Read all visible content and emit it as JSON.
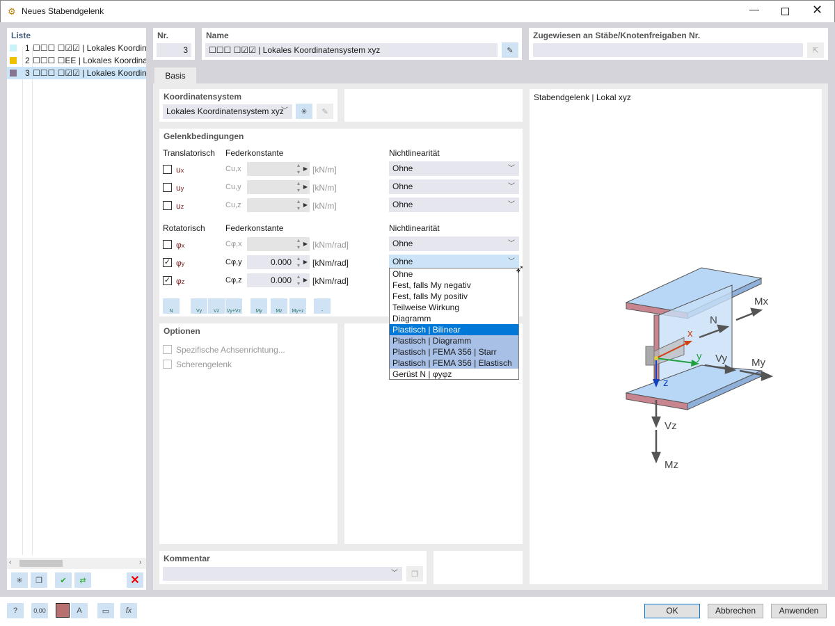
{
  "window": {
    "title": "Neues Stabendgelenk",
    "controls": [
      "minimize",
      "maximize",
      "close"
    ]
  },
  "list": {
    "header": "Liste",
    "items": [
      {
        "no": "1",
        "label": "☐☐☐ ☐☑☑ | Lokales Koordinatensystem xyz",
        "color": "#c8f4f8"
      },
      {
        "no": "2",
        "label": "☐☐☐ ☐EE | Lokales Koordinatensystem xyz",
        "color": "#f0c000"
      },
      {
        "no": "3",
        "label": "☐☐☐ ☐☑☑ | Lokales Koordinatensystem xyz",
        "color": "#857590",
        "selected": true
      }
    ]
  },
  "nr": {
    "label": "Nr.",
    "value": "3"
  },
  "name": {
    "label": "Name",
    "value": "☐☐☐ ☐☑☑ | Lokales Koordinatensystem xyz"
  },
  "assigned": {
    "label": "Zugewiesen an Stäbe/Knotenfreigaben Nr.",
    "value": ""
  },
  "tabs": [
    {
      "label": "Basis",
      "active": true
    }
  ],
  "coord": {
    "label": "Koordinatensystem",
    "value": "Lokales Koordinatensystem xyz"
  },
  "joint": {
    "label": "Gelenkbedingungen",
    "trans_label": "Translatorisch",
    "rot_label": "Rotatorisch",
    "spring_label": "Federkonstante",
    "nonlin_label": "Nichtlinearität",
    "trans": [
      {
        "name": "u",
        "sub": "x",
        "cname": "Cu,x",
        "checked": false,
        "value": "",
        "unit": "[kN/m]",
        "nonlin": "Ohne"
      },
      {
        "name": "u",
        "sub": "y",
        "cname": "Cu,y",
        "checked": false,
        "value": "",
        "unit": "[kN/m]",
        "nonlin": "Ohne"
      },
      {
        "name": "u",
        "sub": "z",
        "cname": "Cu,z",
        "checked": false,
        "value": "",
        "unit": "[kN/m]",
        "nonlin": "Ohne"
      }
    ],
    "rot": [
      {
        "name": "φ",
        "sub": "x",
        "cname": "Cφ,x",
        "checked": false,
        "value": "",
        "unit": "[kNm/rad]",
        "nonlin": "Ohne"
      },
      {
        "name": "φ",
        "sub": "y",
        "cname": "Cφ,y",
        "checked": true,
        "value": "0.000",
        "unit": "[kNm/rad]",
        "nonlin": "Ohne"
      },
      {
        "name": "φ",
        "sub": "z",
        "cname": "Cφ,z",
        "checked": true,
        "value": "0.000",
        "unit": "[kNm/rad]",
        "nonlin": "Ohne"
      }
    ],
    "quick_buttons": [
      "N",
      "Vy",
      "Vz",
      "Vy+Vz",
      "My",
      "Mz",
      "My+z",
      "-"
    ]
  },
  "dropdown": {
    "options": [
      "Ohne",
      "Fest, falls My negativ",
      "Fest, falls My positiv",
      "Teilweise Wirkung",
      "Diagramm",
      "Plastisch | Bilinear",
      "Plastisch | Diagramm",
      "Plastisch | FEMA 356 | Starr",
      "Plastisch | FEMA 356 | Elastisch",
      "Gerüst N | φyφz"
    ],
    "highlighted": "Plastisch | Bilinear"
  },
  "options": {
    "label": "Optionen",
    "items": [
      "Spezifische Achsenrichtung...",
      "Scherengelenk"
    ]
  },
  "comment": {
    "label": "Kommentar",
    "value": ""
  },
  "preview": {
    "title": "Stabendgelenk | Lokal xyz",
    "labels": {
      "N": "N",
      "Mx": "Mx",
      "Vy": "Vy",
      "My": "My",
      "Vz": "Vz",
      "Mz": "Mz",
      "x": "x",
      "y": "y",
      "z": "z"
    }
  },
  "footer": {
    "ok": "OK",
    "cancel": "Abbrechen",
    "apply": "Anwenden",
    "zero_label": "0,00"
  }
}
